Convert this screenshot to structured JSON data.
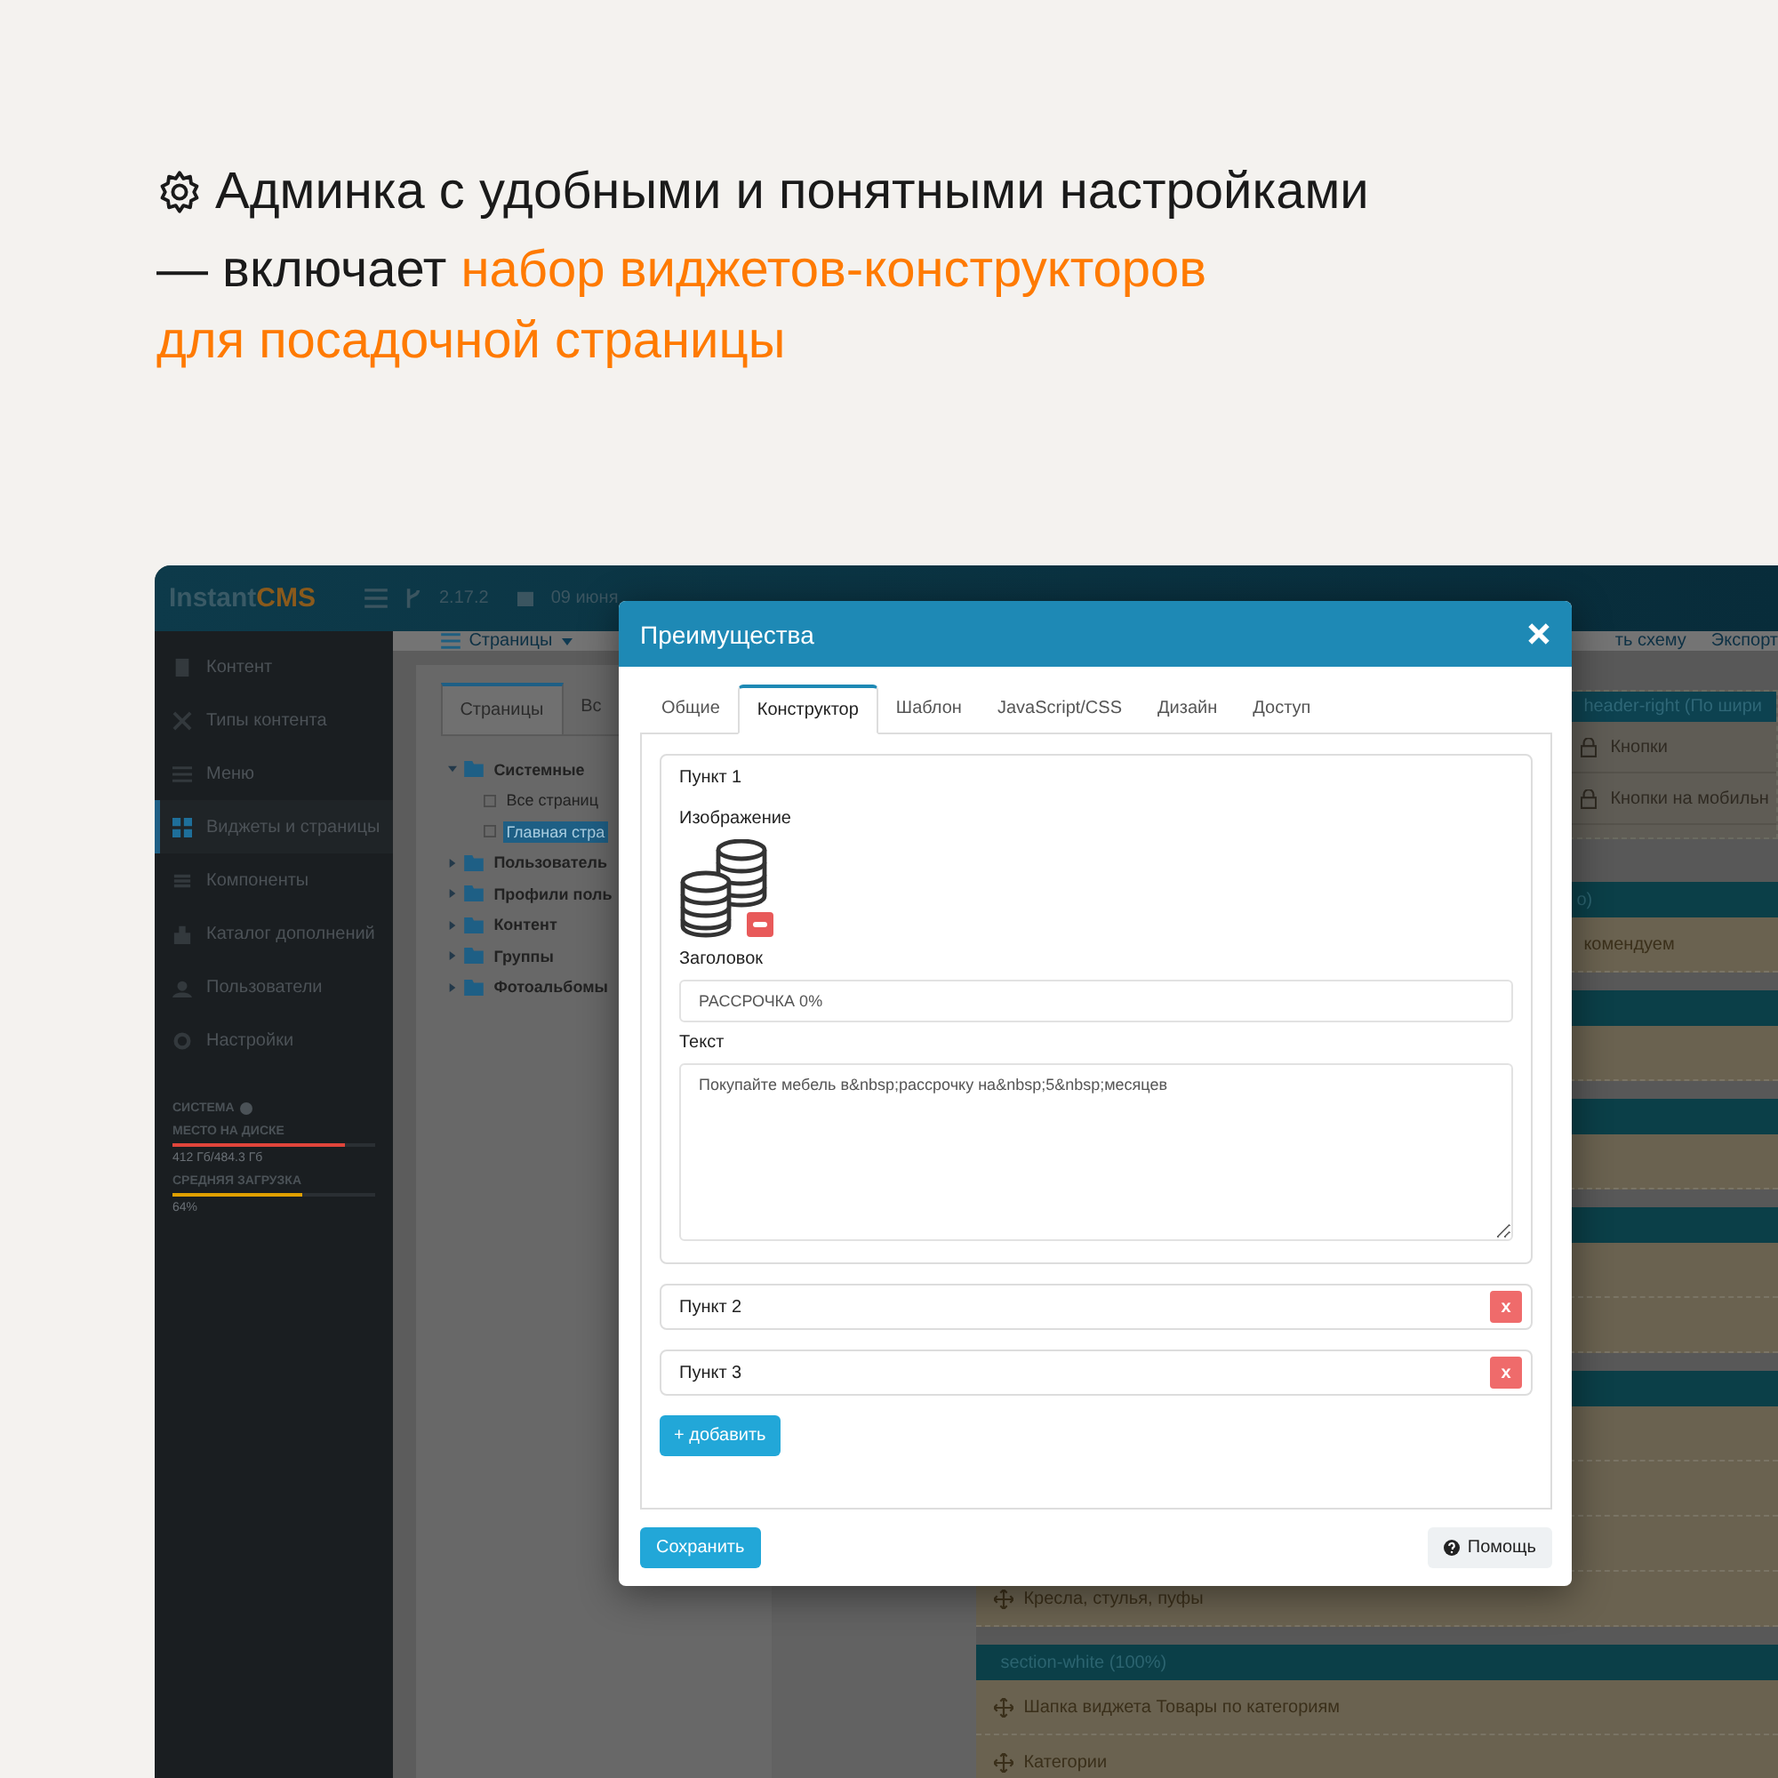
{
  "headline": {
    "lines": [
      [
        {
          "text": "Админка с удобными и понятными настройками",
          "accent": false
        }
      ],
      [
        {
          "text": "— включает ",
          "accent": false
        },
        {
          "text": "набор виджетов-конструкторов",
          "accent": true
        }
      ],
      [
        {
          "text": "для посадочной страницы",
          "accent": true
        }
      ]
    ]
  },
  "admin": {
    "logo": [
      "Instant",
      "CMS"
    ],
    "version": "2.17.2",
    "date": "09 июня",
    "sidebar": {
      "items": [
        {
          "label": "Контент",
          "selected": false
        },
        {
          "label": "Типы контента",
          "selected": false
        },
        {
          "label": "Меню",
          "selected": false
        },
        {
          "label": "Виджеты и страницы",
          "selected": true
        },
        {
          "label": "Компоненты",
          "selected": false
        },
        {
          "label": "Каталог дополнений",
          "selected": false
        },
        {
          "label": "Пользователи",
          "selected": false
        },
        {
          "label": "Настройки",
          "selected": false
        }
      ],
      "system_title": "СИСТЕМА",
      "meters": [
        {
          "label": "МЕСТО НА ДИСКЕ",
          "level": 0.85,
          "reading": "412 Гб/484.3 Гб",
          "color": "#e0453b"
        },
        {
          "label": "СРЕДНЯЯ ЗАГРУЗКА",
          "level": 0.64,
          "reading": "64%",
          "color": "#e0a000"
        }
      ]
    },
    "toolbar": {
      "menu": "Страницы",
      "right": [
        "ть схему",
        "Экспорт"
      ]
    },
    "pages_panel": {
      "tabs": [
        {
          "label": "Страницы",
          "selected": true
        },
        {
          "label": "Вс",
          "selected": false
        }
      ],
      "tree": [
        {
          "label": "Системные",
          "selected": false,
          "children": [
            {
              "label": "Все страниц",
              "selected": false
            },
            {
              "label": "Главная стра",
              "selected": true
            }
          ]
        },
        {
          "label": "Пользователь",
          "selected": false
        },
        {
          "label": "Профили поль",
          "selected": false
        },
        {
          "label": "Контент",
          "selected": false
        },
        {
          "label": "Группы",
          "selected": false
        },
        {
          "label": "Фотоальбомы",
          "selected": false
        }
      ]
    },
    "layout_rows": [
      {
        "kind": "subpanel",
        "title": "header-right (По шири",
        "items": [
          "Кнопки",
          "Кнопки на мобильн"
        ]
      },
      {
        "kind": "section-tail",
        "label": "о)"
      },
      {
        "kind": "item-tail",
        "label": "комендуем"
      },
      {
        "kind": "section"
      },
      {
        "kind": "item"
      },
      {
        "kind": "section"
      },
      {
        "kind": "item"
      },
      {
        "kind": "section"
      },
      {
        "kind": "item"
      },
      {
        "kind": "item"
      },
      {
        "kind": "section"
      },
      {
        "kind": "item"
      },
      {
        "kind": "item"
      },
      {
        "kind": "item"
      },
      {
        "kind": "item",
        "label": "Кресла, стулья, пуфы"
      },
      {
        "kind": "section",
        "label": "section-white (100%)"
      },
      {
        "kind": "item",
        "label": "Шапка виджета Товары по категориям"
      },
      {
        "kind": "item",
        "label": "Категории"
      }
    ]
  },
  "modal": {
    "title": "Преимущества",
    "tabs": [
      {
        "label": "Общие",
        "selected": false
      },
      {
        "label": "Конструктор",
        "selected": true
      },
      {
        "label": "Шаблон",
        "selected": false
      },
      {
        "label": "JavaScript/CSS",
        "selected": false
      },
      {
        "label": "Дизайн",
        "selected": false
      },
      {
        "label": "Доступ",
        "selected": false
      }
    ],
    "items": [
      {
        "title": "Пункт 1",
        "expanded": true,
        "fields": [
          {
            "kind": "image",
            "label": "Изображение"
          },
          {
            "kind": "input",
            "label": "Заголовок",
            "value": "РАССРОЧКА 0%"
          },
          {
            "kind": "textarea",
            "label": "Текст",
            "value": "Покупайте мебель в&nbsp;рассрочку на&nbsp;5&nbsp;месяцев"
          }
        ]
      },
      {
        "title": "Пункт 2",
        "expanded": false,
        "remove": "x"
      },
      {
        "title": "Пункт 3",
        "expanded": false,
        "remove": "x"
      }
    ],
    "add_button": "+ добавить",
    "save_button": "Сохранить",
    "help_button": "Помощь"
  }
}
